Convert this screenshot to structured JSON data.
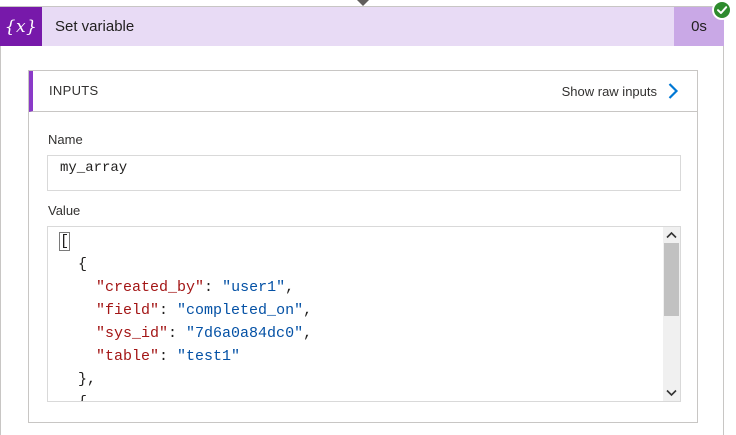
{
  "action": {
    "icon_text": "{x}",
    "title": "Set variable",
    "duration": "0s",
    "status_icon": "success-check-icon"
  },
  "inputs": {
    "section_label": "INPUTS",
    "raw_link_label": "Show raw inputs",
    "name_label": "Name",
    "name_value": "my_array",
    "value_label": "Value"
  },
  "value_code": [
    {
      "indent": "",
      "tokens": [
        {
          "t": "[",
          "c": "p"
        }
      ]
    },
    {
      "indent": "  ",
      "tokens": [
        {
          "t": "{",
          "c": "p"
        }
      ]
    },
    {
      "indent": "    ",
      "tokens": [
        {
          "t": "\"created_by\"",
          "c": "k"
        },
        {
          "t": ": ",
          "c": "p"
        },
        {
          "t": "\"user1\"",
          "c": "s"
        },
        {
          "t": ",",
          "c": "p"
        }
      ]
    },
    {
      "indent": "    ",
      "tokens": [
        {
          "t": "\"field\"",
          "c": "k"
        },
        {
          "t": ": ",
          "c": "p"
        },
        {
          "t": "\"completed_on\"",
          "c": "s"
        },
        {
          "t": ",",
          "c": "p"
        }
      ]
    },
    {
      "indent": "    ",
      "tokens": [
        {
          "t": "\"sys_id\"",
          "c": "k"
        },
        {
          "t": ": ",
          "c": "p"
        },
        {
          "t": "\"7d6a0a84dc0\"",
          "c": "s"
        },
        {
          "t": ",",
          "c": "p"
        }
      ]
    },
    {
      "indent": "    ",
      "tokens": [
        {
          "t": "\"table\"",
          "c": "k"
        },
        {
          "t": ": ",
          "c": "p"
        },
        {
          "t": "\"test1\"",
          "c": "s"
        }
      ]
    },
    {
      "indent": "  ",
      "tokens": [
        {
          "t": "},",
          "c": "p"
        }
      ]
    },
    {
      "indent": "  ",
      "tokens": [
        {
          "t": "{",
          "c": "p"
        }
      ]
    }
  ],
  "colors": {
    "header_bg": "#e8dbf5",
    "icon_bg": "#7719aa",
    "duration_bg": "#c9a8e6",
    "accent_bar": "#8a3ac8",
    "success": "#2e8b2e",
    "link_chevron": "#0078d4",
    "json_key": "#a31515",
    "json_string": "#0451a5"
  }
}
